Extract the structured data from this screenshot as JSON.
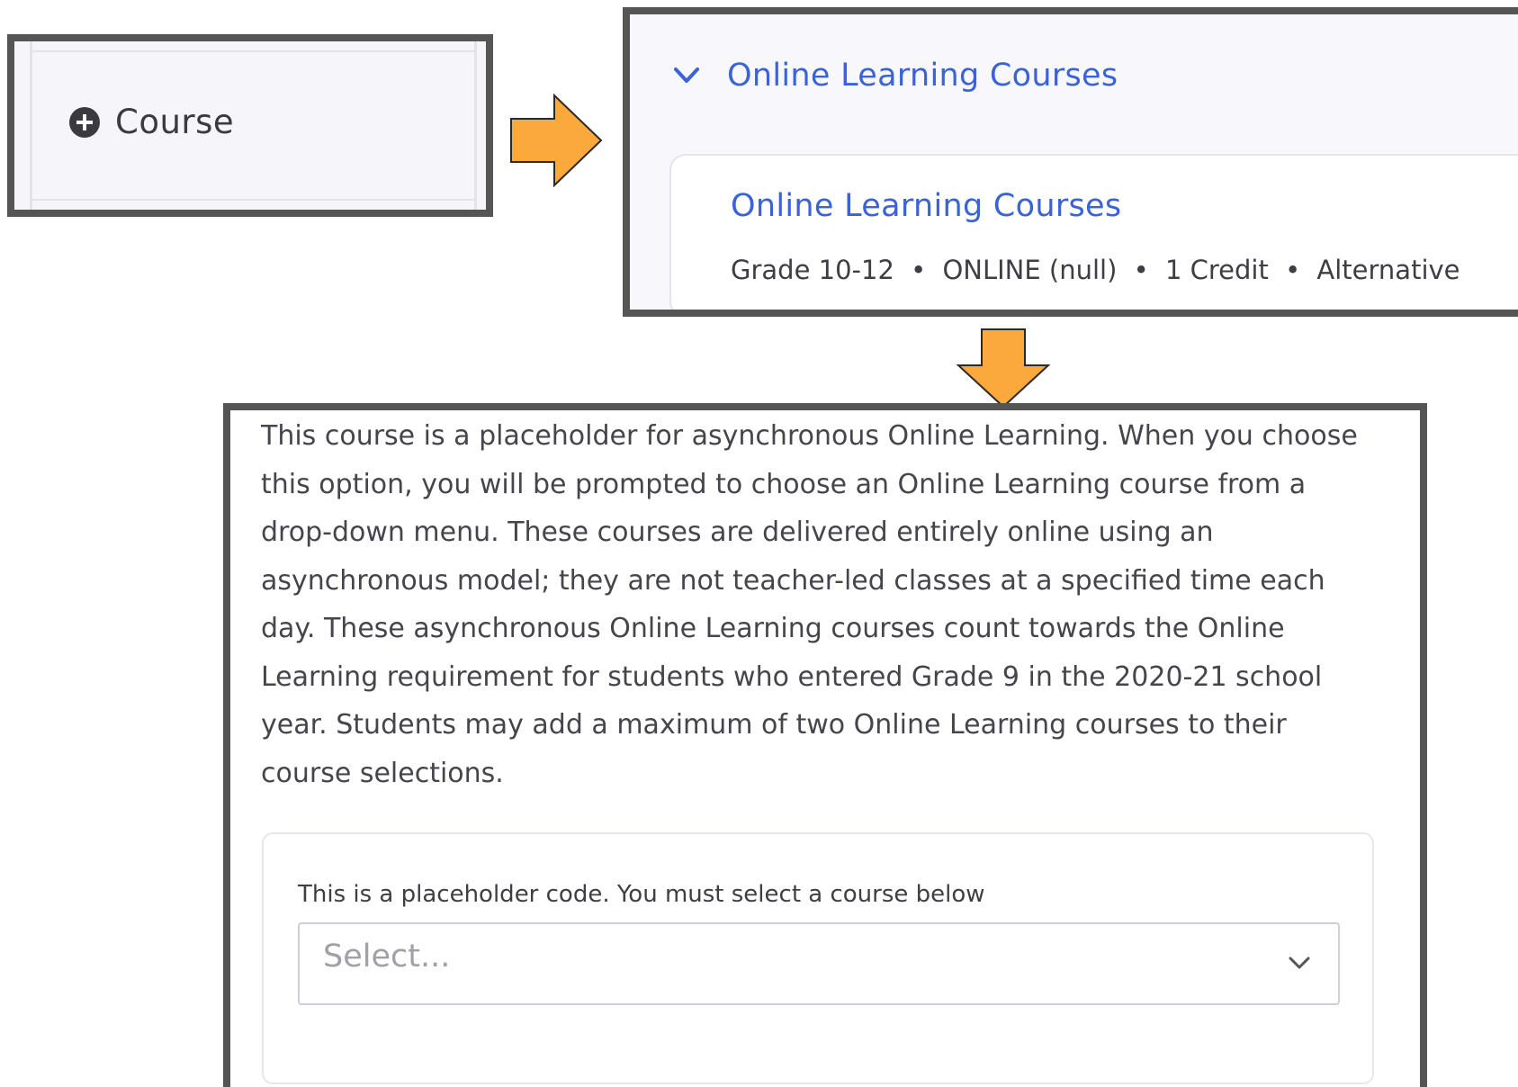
{
  "add_panel": {
    "button_label": "Course",
    "icon": "plus-circle-icon"
  },
  "accordion": {
    "title": "Online Learning Courses",
    "icon": "chevron-down-icon",
    "accent_color": "#3a63d6",
    "course": {
      "title": "Online Learning Courses",
      "meta": [
        "Grade 10-12",
        "ONLINE (null)",
        "1 Credit",
        "Alternative"
      ],
      "separator": "•"
    }
  },
  "detail": {
    "description": "This course is a placeholder for asynchronous Online Learning. When you choose this option, you will be prompted to choose an Online Learning course from a drop-down menu. These courses are delivered entirely online using an asynchronous model; they are not teacher-led classes at a specified time each day. These asynchronous Online Learning courses count towards the Online Learning requirement for students who entered Grade 9 in the 2020-21 school year. Students may add a maximum of two Online Learning courses to their course selections.",
    "select_label": "This is a placeholder code. You must select a course below",
    "select_placeholder": "Select..."
  },
  "arrows": {
    "color": "#fba83c",
    "stroke": "#2a2a2a"
  }
}
